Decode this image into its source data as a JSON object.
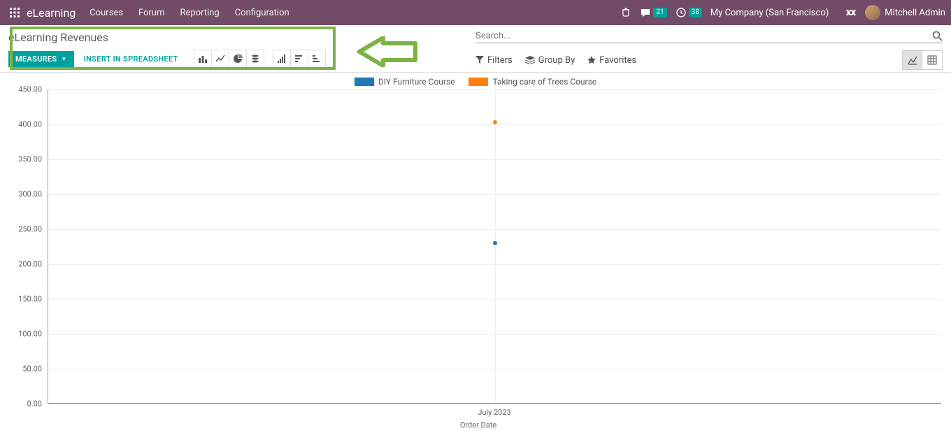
{
  "topbar": {
    "brand": "eLearning",
    "nav": [
      "Courses",
      "Forum",
      "Reporting",
      "Configuration"
    ],
    "messages_badge": "21",
    "activities_badge": "38",
    "company": "My Company (San Francisco)",
    "user": "Mitchell Admin"
  },
  "page": {
    "title": "eLearning Revenues",
    "measures_label": "MEASURES",
    "insert_label": "INSERT IN SPREADSHEET"
  },
  "search": {
    "placeholder": "Search..."
  },
  "filters": {
    "filters_label": "Filters",
    "groupby_label": "Group By",
    "favorites_label": "Favorites"
  },
  "chart_data": {
    "type": "scatter",
    "title": "",
    "xlabel": "Order Date",
    "ylabel": "",
    "ylim": [
      0,
      450
    ],
    "yticks": [
      0,
      50,
      100,
      150,
      200,
      250,
      300,
      350,
      400,
      450
    ],
    "categories": [
      "July 2023"
    ],
    "series": [
      {
        "name": "DIY Furniture Course",
        "color": "#1f77b4",
        "values": [
          230
        ]
      },
      {
        "name": "Taking care of Trees Course",
        "color": "#ff7f0e",
        "values": [
          403
        ]
      }
    ]
  }
}
